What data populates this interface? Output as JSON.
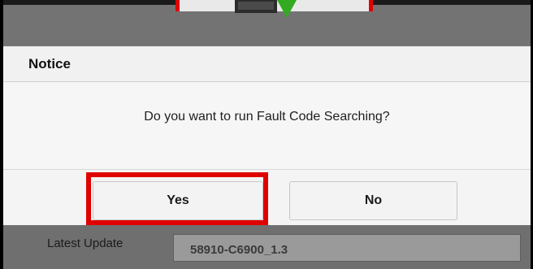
{
  "background": {
    "latest_update_label": "Latest Update",
    "latest_update_value": "58910-C6900_1.3"
  },
  "dialog": {
    "title": "Notice",
    "message": "Do you want to run Fault Code Searching?",
    "yes_label": "Yes",
    "no_label": "No"
  },
  "colors": {
    "highlight": "#e00000",
    "dialog_bg": "#f6f6f6",
    "overlay": "#7c7c7c",
    "device_icon": "#33aa22"
  }
}
